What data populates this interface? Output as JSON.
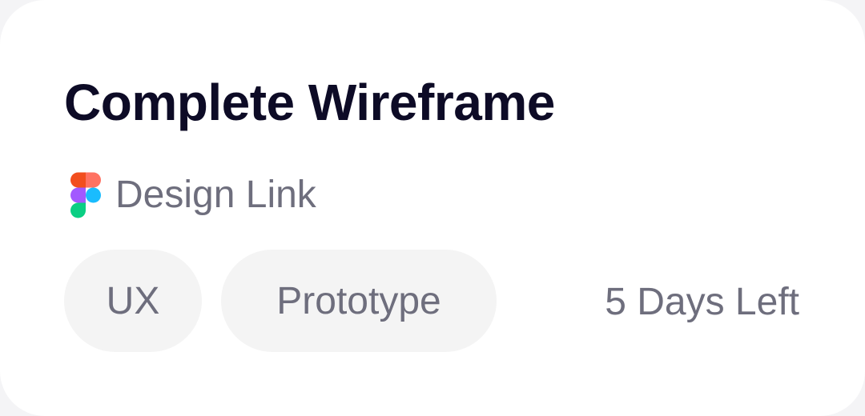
{
  "card": {
    "title": "Complete Wireframe",
    "link": {
      "icon": "figma-icon",
      "label": "Design Link"
    },
    "tags": [
      {
        "label": "UX"
      },
      {
        "label": "Prototype"
      }
    ],
    "deadline": "5 Days Left"
  },
  "colors": {
    "title": "#0d0b26",
    "muted_text": "#6e6e7d",
    "tag_background": "#f4f4f4",
    "card_background": "#ffffff",
    "figma_red": "#f24e1e",
    "figma_orange": "#ff7262",
    "figma_purple": "#a259ff",
    "figma_blue": "#1abcfe",
    "figma_green": "#0acf83"
  }
}
